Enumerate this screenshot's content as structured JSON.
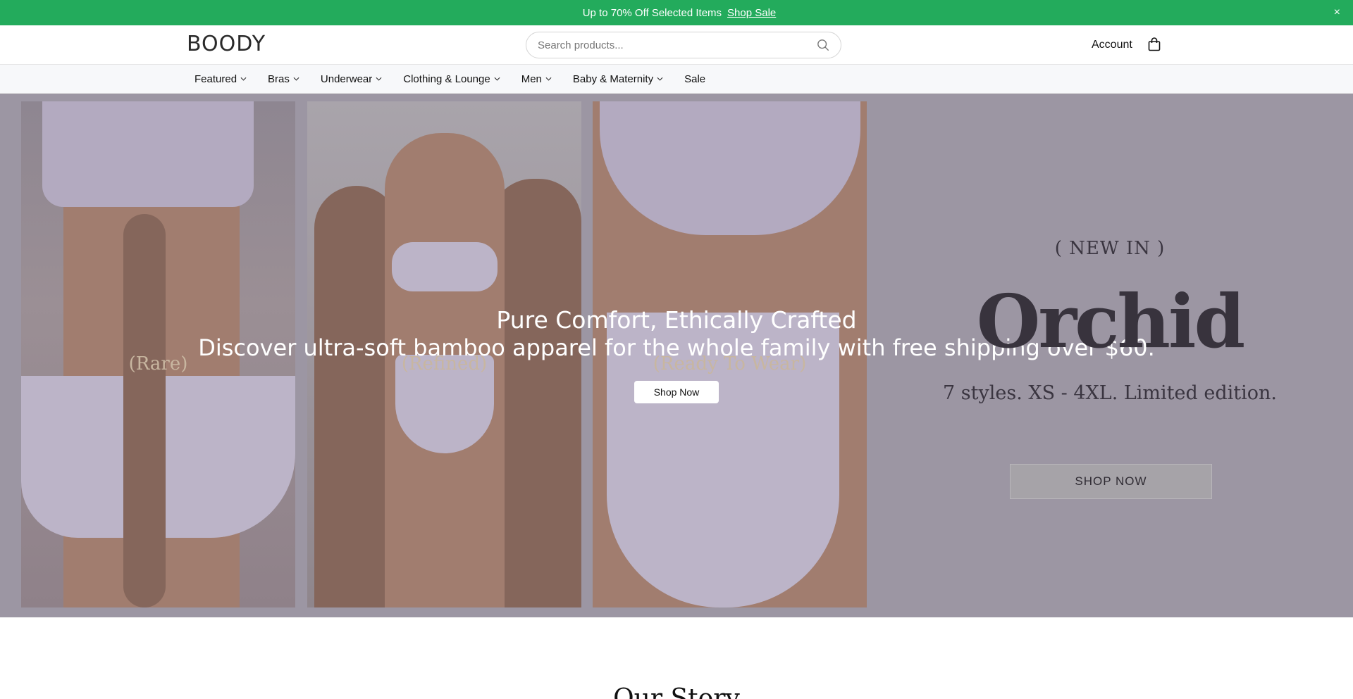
{
  "announcement": {
    "gift_glyph": "",
    "text": "Up to 70% Off Selected Items",
    "link_label": "Shop Sale",
    "close_glyph": "×"
  },
  "header": {
    "logo_text": "BOODY",
    "search_placeholder": "Search products...",
    "account_label": "Account"
  },
  "nav": {
    "items": [
      {
        "label": "Featured",
        "has_dropdown": true
      },
      {
        "label": "Bras",
        "has_dropdown": true
      },
      {
        "label": "Underwear",
        "has_dropdown": true
      },
      {
        "label": "Clothing & Lounge",
        "has_dropdown": true
      },
      {
        "label": "Men",
        "has_dropdown": true
      },
      {
        "label": "Baby & Maternity",
        "has_dropdown": true
      },
      {
        "label": "Sale",
        "has_dropdown": false
      }
    ]
  },
  "hero": {
    "panels": [
      {
        "label": "(Rare)"
      },
      {
        "label": "(Refined)"
      },
      {
        "label": "(Ready To Wear)"
      }
    ],
    "title": "Pure Comfort, Ethically Crafted",
    "subtitle": "Discover ultra-soft bamboo apparel for the whole family with free shipping over $60.",
    "button_label": "Shop Now",
    "promo": {
      "tag": "( NEW IN )",
      "title": "Orchid",
      "description": "7 styles. XS - 4XL. Limited edition.",
      "button_label": "SHOP NOW"
    }
  },
  "story": {
    "heading": "Our Story"
  },
  "colors": {
    "announcement_bg": "#23ab5c",
    "hero_bg": "#9c96a3"
  }
}
